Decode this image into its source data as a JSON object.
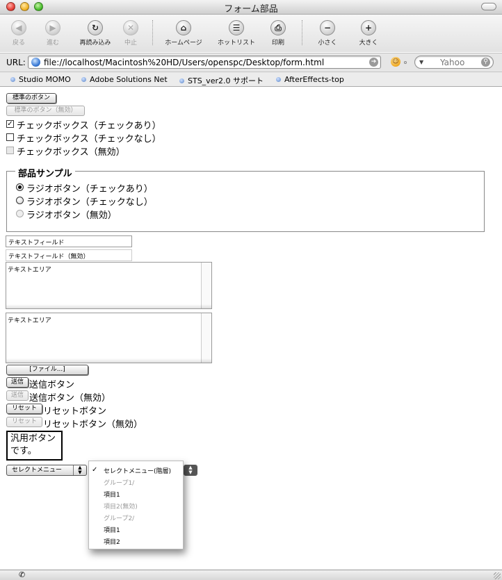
{
  "window": {
    "title": "フォーム部品"
  },
  "toolbar": {
    "back": "戻る",
    "forward": "進む",
    "reload": "再読み込み",
    "stop": "中止",
    "home": "ホームページ",
    "hotlist": "ホットリスト",
    "print": "印刷",
    "smaller": "小さく",
    "larger": "大きく"
  },
  "address": {
    "label": "URL:",
    "url": "file://localhost/Macintosh%20HD/Users/openspc/Desktop/form.html",
    "search_placeholder": "Yahoo"
  },
  "bookmarks": [
    "Studio MOMO",
    "Adobe Solutions Net",
    "STS_ver2.0 サポート",
    "AfterEffects-top"
  ],
  "form": {
    "std_button": "標準のボタン",
    "std_button_disabled": "標準のボタン（無効）",
    "checkboxes": [
      {
        "label": "チェックボックス（チェックあり）",
        "checked": true,
        "disabled": false
      },
      {
        "label": "チェックボックス（チェックなし）",
        "checked": false,
        "disabled": false
      },
      {
        "label": "チェックボックス（無効）",
        "checked": false,
        "disabled": true
      }
    ],
    "fieldset_legend": "部品サンプル",
    "radios": [
      {
        "label": "ラジオボタン（チェックあり）",
        "checked": true,
        "disabled": false
      },
      {
        "label": "ラジオボタン（チェックなし）",
        "checked": false,
        "disabled": false
      },
      {
        "label": "ラジオボタン（無効）",
        "checked": false,
        "disabled": true
      }
    ],
    "text_field": "テキストフィールド",
    "text_field_disabled": "テキストフィールド（無効）",
    "textarea_1": "テキストエリア",
    "textarea_2": "テキストエリア",
    "file_button": "[ファイル...]",
    "submit_button": "送信",
    "submit_label": "送信ボタン",
    "submit_disabled_button": "送信",
    "submit_disabled_label": "送信ボタン（無効）",
    "reset_button": "リセット",
    "reset_label": "リセットボタン",
    "reset_disabled_button": "リセット",
    "reset_disabled_label": "リセットボタン（無効）",
    "generic_button_line1": "汎用ボタン",
    "generic_button_line2": "です。",
    "select_menu": "セレクトメニュー",
    "popup": {
      "items": [
        {
          "label": "セレクトメニュー(階層)",
          "checked": true,
          "grey": false
        },
        {
          "label": "グループ1/",
          "checked": false,
          "grey": true
        },
        {
          "label": "項目1",
          "checked": false,
          "grey": false
        },
        {
          "label": "項目2(無効)",
          "checked": false,
          "grey": true
        },
        {
          "label": "グループ2/",
          "checked": false,
          "grey": true
        },
        {
          "label": "項目1",
          "checked": false,
          "grey": false
        },
        {
          "label": "項目2",
          "checked": false,
          "grey": false
        }
      ]
    }
  }
}
